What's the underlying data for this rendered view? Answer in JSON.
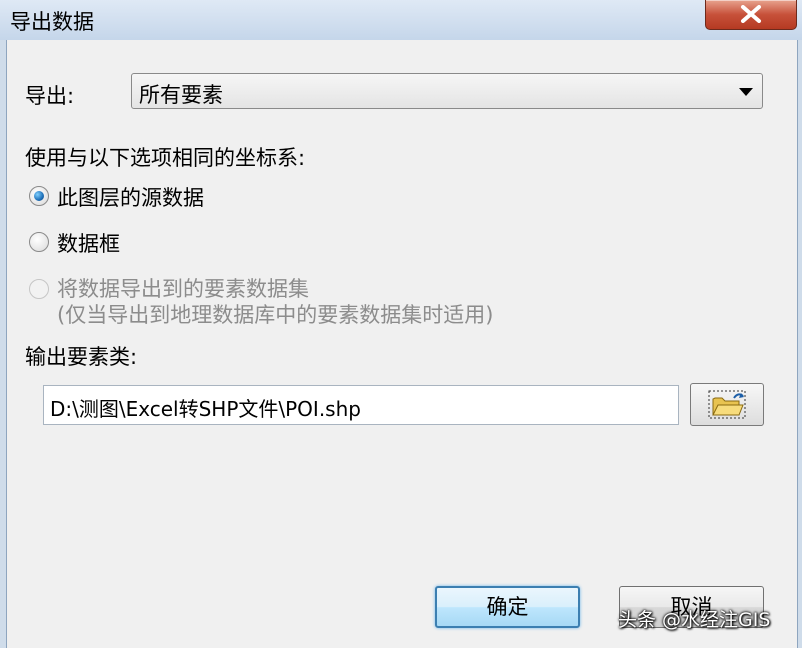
{
  "window": {
    "title": "导出数据"
  },
  "export": {
    "label": "导出:",
    "value": "所有要素"
  },
  "coord_system": {
    "label": "使用与以下选项相同的坐标系:",
    "options": [
      {
        "label": "此图层的源数据",
        "checked": true,
        "enabled": true
      },
      {
        "label": "数据框",
        "checked": false,
        "enabled": true
      },
      {
        "label": "将数据导出到的要素数据集",
        "note": "(仅当导出到地理数据库中的要素数据集时适用)",
        "checked": false,
        "enabled": false
      }
    ]
  },
  "output": {
    "label": "输出要素类:",
    "path": "D:\\测图\\Excel转SHP文件\\POI.shp"
  },
  "buttons": {
    "ok": "确定",
    "cancel": "取消"
  },
  "watermark": "头条 @水经注GIS",
  "icons": {
    "close": "close-icon",
    "dropdown": "chevron-down-icon",
    "browse": "folder-open-icon"
  }
}
